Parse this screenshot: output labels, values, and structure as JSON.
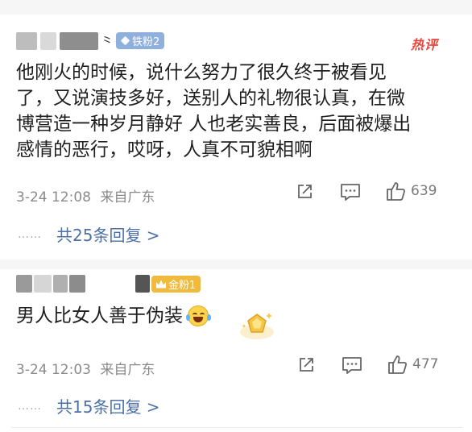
{
  "comments": [
    {
      "username_suffix": "...",
      "badge": "铁粉2",
      "hot_label": "热评",
      "content_lines": [
        "他刚火的时候，说什么努力了很久终于被看见",
        "了，又说演技多好，送别人的礼物很认真，在微",
        "博营造一种岁月静好 人也老实善良，后面被爆出",
        "感情的恶行，哎呀，人真不可貌相啊"
      ],
      "timestamp": "3-24 12:08",
      "location": "来自广东",
      "likes": "639",
      "replies": "共25条回复 >",
      "dots": "……"
    },
    {
      "badge": "金粉1",
      "content": "男人比女人善于伪装",
      "emoji": "laugh-cry",
      "timestamp": "3-24 12:03",
      "location": "来自广东",
      "likes": "477",
      "replies": "共15条回复 >",
      "dots": "……"
    }
  ],
  "colors": {
    "link": "#4b70a8",
    "hot": "#e8453c",
    "iron_badge": "#8fb0dd",
    "gold_badge": "#f0ba3e",
    "meta": "#8a8a8a"
  }
}
